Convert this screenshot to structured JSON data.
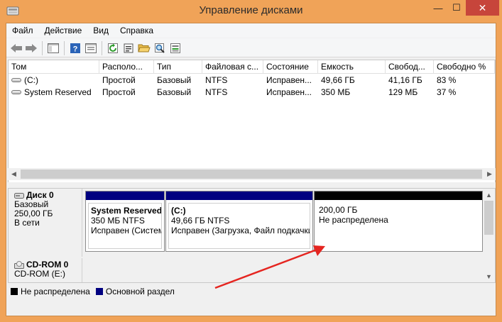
{
  "window": {
    "title": "Управление дисками",
    "min_glyph": "—",
    "max_glyph": "☐",
    "close_glyph": "✕"
  },
  "menu": [
    "Файл",
    "Действие",
    "Вид",
    "Справка"
  ],
  "toolbar_icons": [
    "back-arrow-icon",
    "forward-arrow-icon",
    "console-tree-icon",
    "help-icon",
    "properties-list-icon",
    "refresh-icon",
    "properties-icon",
    "open-folder-icon",
    "search-icon",
    "settings-icon"
  ],
  "volume_table": {
    "headers": [
      "Том",
      "Располо...",
      "Тип",
      "Файловая с...",
      "Состояние",
      "Емкость",
      "Свобод...",
      "Свободно %"
    ],
    "rows": [
      {
        "name": "(C:)",
        "layout": "Простой",
        "type": "Базовый",
        "fs": "NTFS",
        "status": "Исправен...",
        "capacity": "49,66 ГБ",
        "free": "41,16 ГБ",
        "free_pct": "83 %"
      },
      {
        "name": "System Reserved",
        "layout": "Простой",
        "type": "Базовый",
        "fs": "NTFS",
        "status": "Исправен...",
        "capacity": "350 МБ",
        "free": "129 МБ",
        "free_pct": "37 %"
      }
    ]
  },
  "disks": [
    {
      "name": "Диск 0",
      "type": "Базовый",
      "size": "250,00 ГБ",
      "status": "В сети",
      "partitions": [
        {
          "name": "System Reserved",
          "size_fs": "350 МБ NTFS",
          "status": "Исправен (Систем",
          "bar_color": "#000080"
        },
        {
          "name": "(C:)",
          "size_fs": "49,66 ГБ NTFS",
          "status": "Исправен (Загрузка, Файл подкачки",
          "bar_color": "#000080"
        },
        {
          "name": "",
          "size_fs": "200,00 ГБ",
          "status": "Не распределена",
          "bar_color": "#000000"
        }
      ]
    },
    {
      "name": "CD-ROM 0",
      "type": "CD-ROM (E:)"
    }
  ],
  "legend": [
    {
      "label": "Не распределена",
      "color": "#000000"
    },
    {
      "label": "Основной раздел",
      "color": "#000080"
    }
  ],
  "colors": {
    "frame": "#f0a358",
    "close_button": "#c7453b",
    "primary_partition": "#000080",
    "unallocated": "#000000",
    "annotation_arrow": "#e52520"
  }
}
